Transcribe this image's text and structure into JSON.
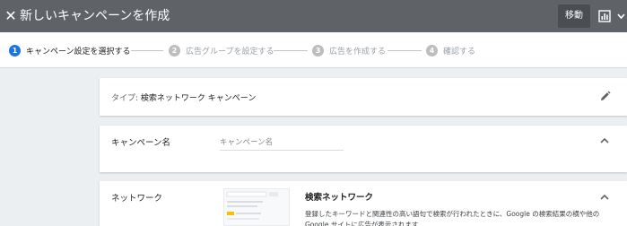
{
  "header": {
    "close_glyph": "✕",
    "title": "新しいキャンペーンを作成",
    "move_label": "移動",
    "icons": [
      "close-icon",
      "bar-chart-icon",
      "chevron-down-icon"
    ]
  },
  "steps": [
    {
      "num": "1",
      "label": "キャンペーン設定を選択する",
      "active": true
    },
    {
      "num": "2",
      "label": "広告グループを設定する",
      "active": false
    },
    {
      "num": "3",
      "label": "広告を作成する",
      "active": false
    },
    {
      "num": "4",
      "label": "確認する",
      "active": false
    }
  ],
  "type_card": {
    "label": "タイプ: ",
    "value": "検索ネットワーク キャンペーン",
    "icon": "pencil-icon"
  },
  "name_card": {
    "label": "キャンペーン名",
    "placeholder": "キャンペーン名",
    "icon": "chevron-up-icon"
  },
  "network_card": {
    "label": "ネットワーク",
    "option_title": "検索ネットワーク",
    "option_desc": "登録したキーワードと関連性の高い語句で検索が行われたときに、Google の検索結果の横や他の Google サイトに広告が表示されます",
    "icon": "chevron-up-icon"
  },
  "colors": {
    "topbar": "#5f6368",
    "active_step": "#1a73e8",
    "inactive_step": "#bdbdbd",
    "background": "#eceff1"
  }
}
